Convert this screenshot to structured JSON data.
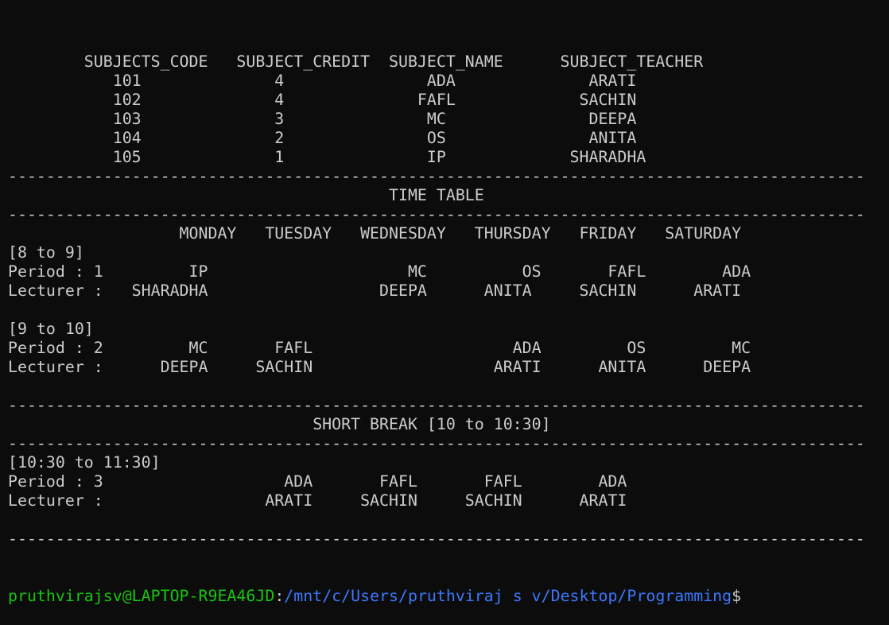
{
  "terminal": {
    "lines": [
      "        SUBJECTS_CODE   SUBJECT_CREDIT  SUBJECT_NAME      SUBJECT_TEACHER",
      "           101              4               ADA              ARATI",
      "           102              4              FAFL             SACHIN",
      "           103              3               MC               DEEPA",
      "           104              2               OS               ANITA",
      "           105              1               IP             SHARADHA",
      "------------------------------------------------------------------------------------------",
      "                                        TIME TABLE",
      "------------------------------------------------------------------------------------------",
      "                  MONDAY   TUESDAY   WEDNESDAY   THURSDAY   FRIDAY   SATURDAY",
      "[8 to 9]",
      "Period : 1         IP                     MC          OS       FAFL        ADA",
      "Lecturer :   SHARADHA                  DEEPA      ANITA     SACHIN      ARATI",
      "",
      "[9 to 10]",
      "Period : 2         MC       FAFL                     ADA         OS         MC",
      "Lecturer :      DEEPA     SACHIN                   ARATI      ANITA      DEEPA",
      "",
      "------------------------------------------------------------------------------------------",
      "                                SHORT BREAK [10 to 10:30]",
      "------------------------------------------------------------------------------------------",
      "[10:30 to 11:30]",
      "Period : 3                   ADA       FAFL       FAFL        ADA",
      "Lecturer :                 ARATI     SACHIN     SACHIN      ARATI",
      "",
      "------------------------------------------------------------------------------------------"
    ],
    "prompt": {
      "user_host": "pruthvirajsv@LAPTOP-R9EA46JD",
      "separator": ":",
      "path": "/mnt/c/Users/pruthviraj s v/Desktop/Programming",
      "symbol": "$"
    }
  }
}
